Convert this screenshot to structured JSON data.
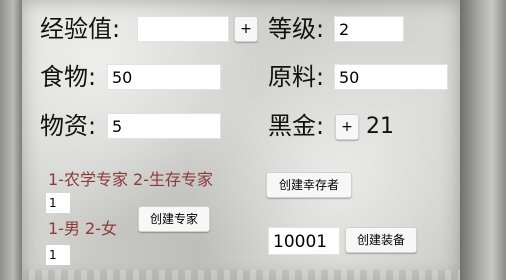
{
  "row1": {
    "exp_label": "经验值:",
    "exp_value": "",
    "exp_plus": "+",
    "level_label": "等级:",
    "level_value": "2"
  },
  "row2": {
    "food_label": "食物:",
    "food_value": "50",
    "material_label": "原料:",
    "material_value": "50"
  },
  "row3": {
    "supplies_label": "物资:",
    "supplies_value": "5",
    "blackgold_label": "黑金:",
    "blackgold_plus": "+",
    "blackgold_value": "21"
  },
  "expert": {
    "type_hint": "1-农学专家 2-生存专家",
    "type_value": "1",
    "gender_hint": "1-男 2-女",
    "gender_value": "1",
    "create_button": "创建专家"
  },
  "survivor": {
    "create_button": "创建幸存者"
  },
  "equipment": {
    "id_value": "10001",
    "create_button": "创建装备"
  }
}
